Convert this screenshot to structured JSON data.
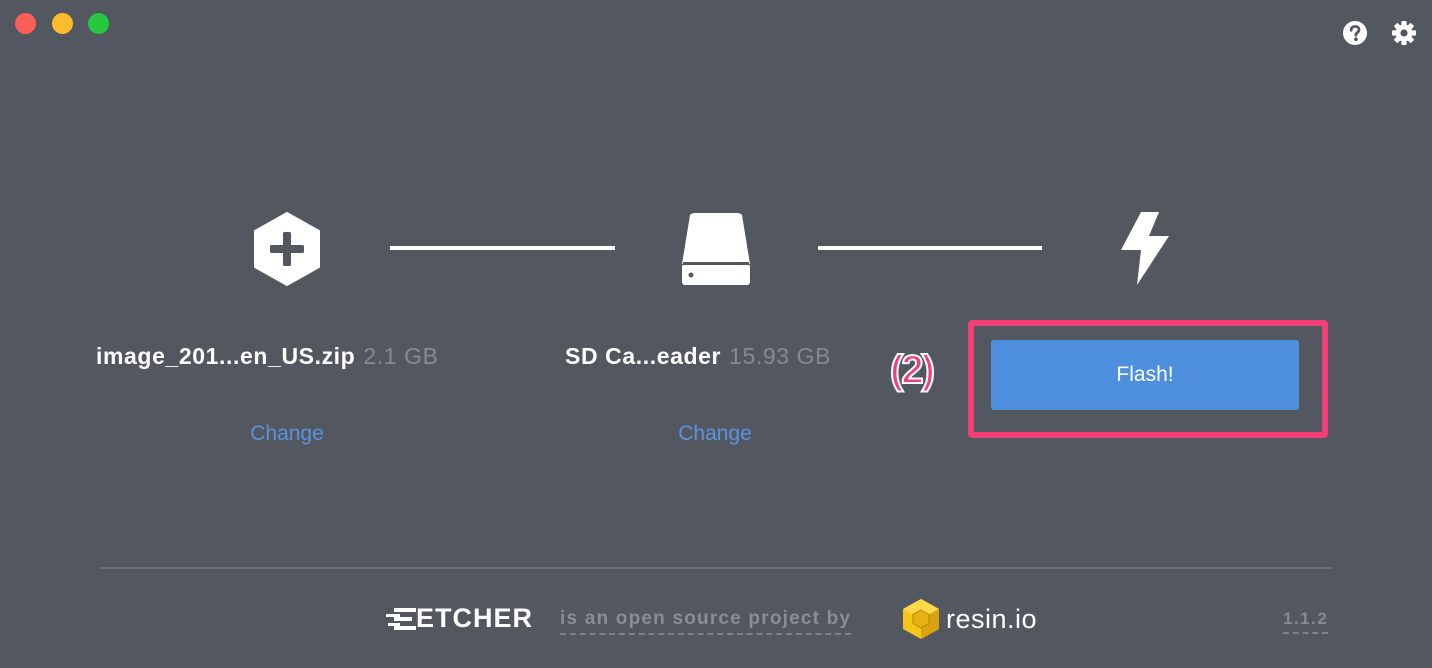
{
  "window": {
    "controls": [
      "close",
      "minimize",
      "maximize"
    ]
  },
  "toolbar": {
    "help_icon": "help-circle-icon",
    "settings_icon": "gear-icon"
  },
  "steps": {
    "image": {
      "icon": "add-hexagon-icon",
      "name": "image_201...en_US.zip",
      "size": "2.1 GB",
      "change_label": "Change"
    },
    "drive": {
      "icon": "drive-icon",
      "name": "SD Ca...eader",
      "size": "15.93 GB",
      "change_label": "Change"
    },
    "flash": {
      "icon": "lightning-icon",
      "button_label": "Flash!"
    }
  },
  "annotation": {
    "number": "(2)",
    "color": "#f23f7a"
  },
  "footer": {
    "brand": "ETCHER",
    "tagline": "is an open source project by",
    "company": "resin.io",
    "version": "1.1.2"
  },
  "colors": {
    "background": "#535760",
    "accent": "#4e8fdd",
    "link": "#5b93de"
  }
}
